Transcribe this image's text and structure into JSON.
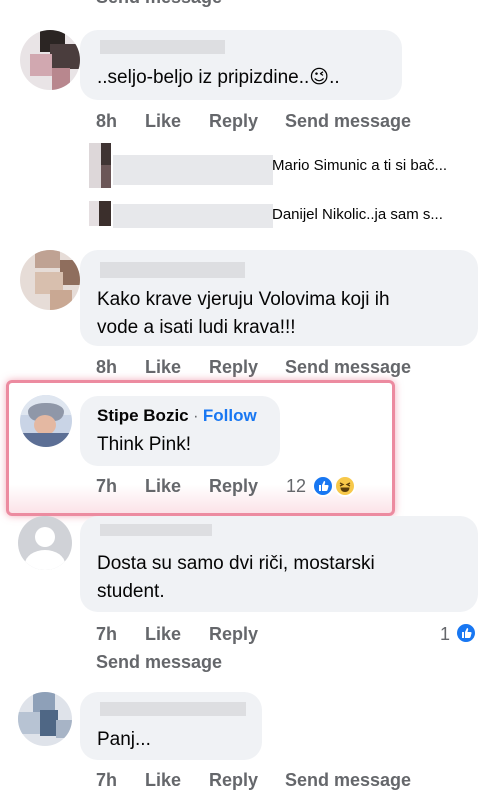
{
  "top_cutoff": {
    "send_label": "Send message"
  },
  "comments": [
    {
      "text": "..seljo-beljo iz pripizdine..😉..",
      "time": "8h",
      "like": "Like",
      "reply": "Reply",
      "send": "Send message",
      "replies": [
        {
          "text": "Mario Simunic a ti si bač..."
        },
        {
          "text": "Danijel Nikolic..ja sam s..."
        }
      ]
    },
    {
      "text_line1": "Kako krave vjeruju Volovima koji ih",
      "text_line2": "vode a isati ludi krava!!!",
      "time": "8h",
      "like": "Like",
      "reply": "Reply",
      "send": "Send message"
    },
    {
      "author": "Stipe Bozic",
      "separator": "·",
      "follow": "Follow",
      "text": "Think Pink!",
      "time": "7h",
      "like": "Like",
      "reply": "Reply",
      "reaction_count": "12"
    },
    {
      "text_line1": "Dosta su samo dvi riči, mostarski",
      "text_line2": "student.",
      "time": "7h",
      "like": "Like",
      "reply": "Reply",
      "send": "Send message",
      "reaction_count": "1"
    },
    {
      "text": "Panj...",
      "time": "7h",
      "like": "Like",
      "reply": "Reply",
      "send": "Send message"
    }
  ],
  "colors": {
    "highlight": "#ec8ba0",
    "link": "#1877f2",
    "meta": "#65676b",
    "bubble": "#f0f2f5"
  }
}
